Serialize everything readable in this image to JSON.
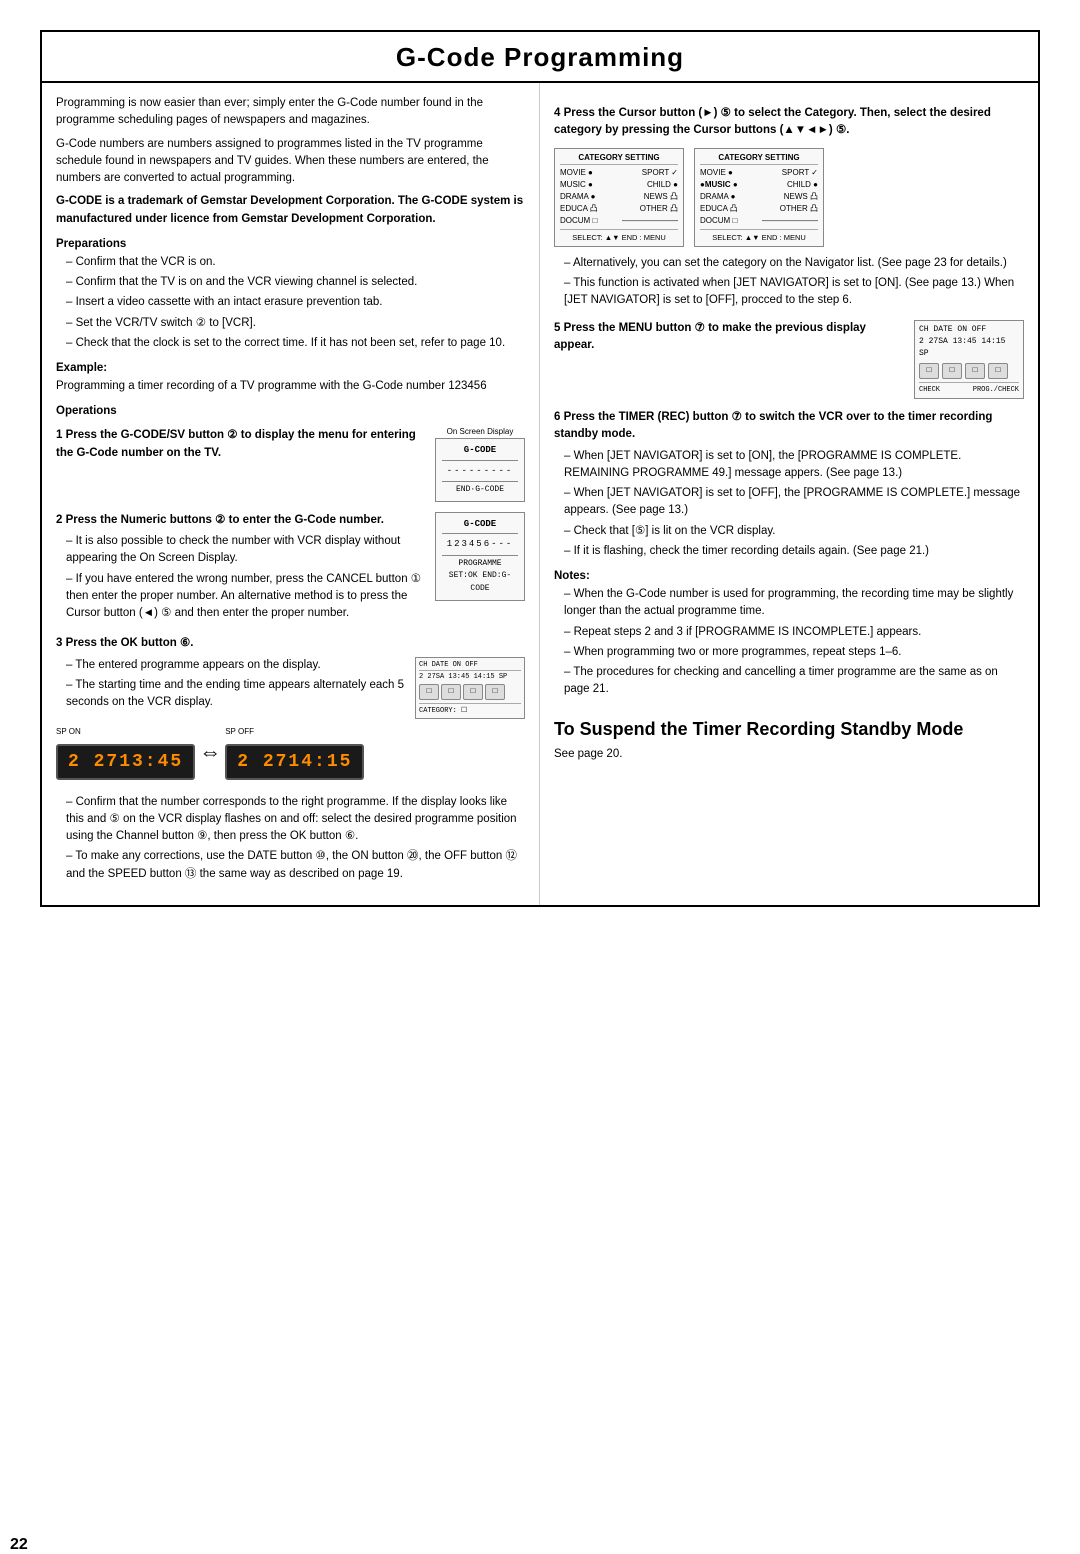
{
  "page": {
    "number": "22",
    "title": "G-Code  Programming"
  },
  "left": {
    "intro1": "Programming is now easier than ever; simply enter the G-Code number found in the programme scheduling pages of newspapers and magazines.",
    "intro2": "G-Code numbers are numbers assigned to programmes listed in the TV programme schedule found in newspapers and TV guides. When these numbers are entered, the numbers are converted to actual programming.",
    "trademark": "G-CODE is a trademark of Gemstar Development Corporation. The G-CODE system is manufactured under licence from Gemstar Development Corporation.",
    "preparations_heading": "Preparations",
    "prep_items": [
      "Confirm that the VCR is on.",
      "Confirm that the TV is on and the VCR viewing channel is selected.",
      "Insert a video cassette with an intact erasure prevention tab.",
      "Set the VCR/TV switch ② to [VCR].",
      "Check that the clock is set to the correct time. If it has not been set, refer to page 10."
    ],
    "example_heading": "Example:",
    "example_text": "Programming a timer recording of a TV programme with the G-Code number 123456",
    "operations_heading": "Operations",
    "step1_heading": "1  Press the G-CODE/SV button ② to display the menu for entering the G-Code number on the TV.",
    "step1_osd": {
      "title": "G-CODE",
      "line1": "---------",
      "footer": "END·G-CODE"
    },
    "step1_label": "On Screen Display",
    "step2_heading": "2  Press the Numeric buttons ② to enter the G-Code number.",
    "step2_bullet1": "It is also possible to check the number with VCR display without appearing the On Screen Display.",
    "step2_bullet2": "If you have entered the wrong number, press the CANCEL button ① then enter the proper number. An alternative method is to press the Cursor button (◄) ⑤ and then enter the proper number.",
    "step2_osd": {
      "title": "G-CODE",
      "line1": "123456---",
      "footer": "PROGRAMME SET:OK    END:G-CODE"
    },
    "step3_heading": "3  Press the OK button ⑥.",
    "step3_bullets": [
      "The entered programme appears on the display.",
      "The starting time and the ending time appears alternately each 5 seconds on the VCR display."
    ],
    "vcr_display1": "2 2713:45",
    "vcr_display2": "2 2714:15",
    "vcr_label1": "SP ON",
    "vcr_label2": "SP OFF",
    "step3_bullets2": [
      "Confirm that the number corresponds to the right programme. If the display looks like this and ⑤ on the VCR display flashes on and off: select the desired programme position using the Channel button ⑨, then press the OK button ⑥.",
      "To make any corrections, use the DATE button ⑩, the ON button ⑳, the OFF button ⑫ and the SPEED button ⑬ the same way as described on page 19."
    ]
  },
  "right": {
    "step4_heading": "4  Press the Cursor button (►) ⑤ to select the Category. Then, select the desired category by pressing the Cursor buttons (▲▼◄►) ⑤.",
    "cat_left": {
      "title": "CATEGORY SETTING",
      "items": [
        [
          "MOVIE",
          "●SPORT",
          "✓"
        ],
        [
          "MUSIC",
          "●",
          "CHILD",
          "●"
        ],
        [
          "DRAMA",
          "●",
          "NEWS",
          "凸"
        ],
        [
          "EDUCA",
          "凸",
          "OTHER",
          "凸"
        ],
        [
          "DOCUM",
          "□",
          "———————"
        ]
      ],
      "footer": "SELECT: ▲▼  END : MENU"
    },
    "cat_right": {
      "title": "CATEGORY SETTING",
      "items": [
        [
          "MOVIE",
          "●SPORT",
          "✓"
        ],
        [
          "●MUSIC",
          "●",
          "CHILD",
          "●"
        ],
        [
          "DRAMA",
          "●",
          "NEWS",
          "凸"
        ],
        [
          "EDUCA",
          "凸",
          "OTHER",
          "凸"
        ],
        [
          "DOCUM",
          "□",
          "———————"
        ]
      ],
      "footer": "SELECT: ▲▼  END : MENU"
    },
    "step4_bullet1": "Alternatively, you can set the category on the Navigator list. (See page 23 for details.)",
    "step4_bullet2": "This function is activated when [JET NAVIGATOR] is set to [ON]. (See page 13.) When [JET NAVIGATOR] is set to [OFF], procced to the step 6.",
    "step5_heading": "5  Press the MENU button ⑦ to make the previous display appear.",
    "step5_img": {
      "header": "CH DATE ON   OFF",
      "row1": "2  27SA  13:45  14:15  SP",
      "buttons": [
        "□",
        "□",
        "□",
        "□"
      ],
      "footer_left": "CHECK",
      "footer_right": "PROG./CHECK"
    },
    "step6_heading": "6  Press the TIMER (REC) button ⑦ to switch the VCR over to the timer recording standby mode.",
    "step6_bullets": [
      "When [JET NAVIGATOR] is set to [ON], the [PROGRAMME IS COMPLETE. REMAINING PROGRAMME 49.] message appers. (See page 13.)",
      "When [JET NAVIGATOR] is set to [OFF], the [PROGRAMME IS COMPLETE.] message appears. (See page 13.)",
      "Check that [⑤] is lit on the VCR display.",
      "If it is flashing, check the timer recording details again. (See page 21.)"
    ],
    "notes_heading": "Notes:",
    "notes_items": [
      "When the G-Code number is used for programming, the recording time may be slightly longer than the actual programme time.",
      "Repeat steps 2 and 3 if [PROGRAMME IS INCOMPLETE.] appears.",
      "When programming two or more programmes, repeat steps 1–6.",
      "The procedures for checking and cancelling a timer programme are the same as on page 21."
    ],
    "subtitle_heading": "To Suspend the Timer Recording Standby Mode",
    "subtitle_body": "See page 20."
  }
}
